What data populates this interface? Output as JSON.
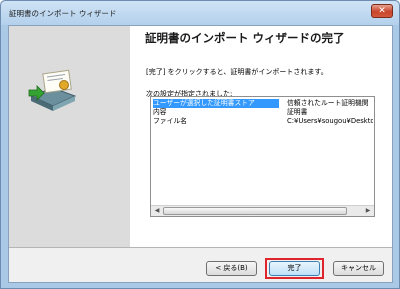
{
  "window": {
    "title": "証明書のインポート ウィザード",
    "close_label": "✕"
  },
  "wizard": {
    "heading": "証明書のインポート ウィザードの完了",
    "description": "[完了] をクリックすると、証明書がインポートされます。",
    "settings_label": "次の設定が指定されました:"
  },
  "settings": [
    {
      "key": "ユーザーが選択した証明書ストア",
      "value": "信頼されたルート証明機関"
    },
    {
      "key": "内容",
      "value": "証明書"
    },
    {
      "key": "ファイル名",
      "value": "C:¥Users¥sougou¥Desktop¥cac"
    }
  ],
  "buttons": {
    "back": "< 戻る(B)",
    "finish": "完了",
    "cancel": "キャンセル"
  },
  "colors": {
    "selection": "#3399ff",
    "highlight": "#e0242c"
  }
}
